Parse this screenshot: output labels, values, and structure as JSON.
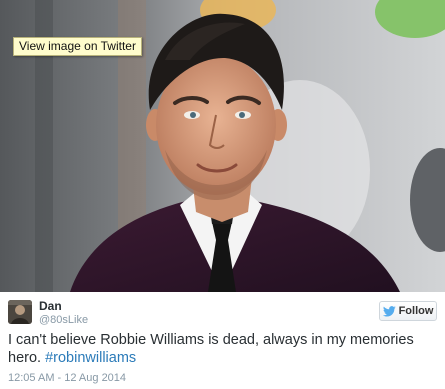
{
  "tooltip": {
    "label": "View image on Twitter"
  },
  "tweet": {
    "display_name": "Dan",
    "handle": "@80sLike",
    "follow_label": "Follow",
    "text_before": "I can't believe Robbie Williams is dead, always in my memories hero.",
    "hashtag": "#robinwilliams",
    "timestamp": "12:05 AM - 12 Aug 2014"
  },
  "colors": {
    "link": "#2b7bb9",
    "muted": "#8899a6",
    "text": "#292f33",
    "tooltip_bg": "#fffccc"
  },
  "icons": {
    "follow": "twitter-bird-icon"
  }
}
